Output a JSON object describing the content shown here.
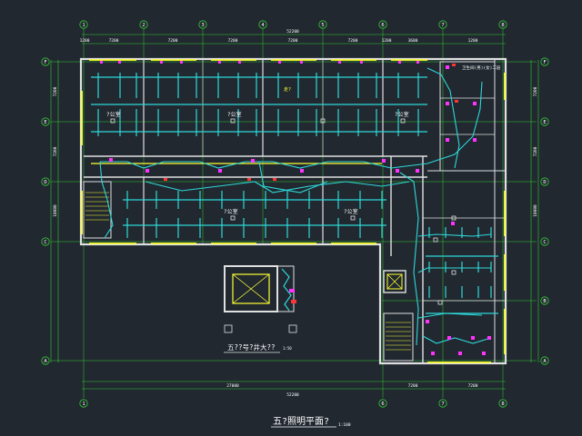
{
  "axes": {
    "top_labels": [
      "1",
      "2",
      "3",
      "4",
      "5",
      "6",
      "7",
      "8"
    ],
    "bottom_labels": [
      "1",
      "6",
      "7",
      "8"
    ],
    "left_labels": [
      "F",
      "E",
      "D",
      "C",
      "A"
    ],
    "right_labels": [
      "F",
      "E",
      "D",
      "C",
      "B",
      "A"
    ]
  },
  "dimensions": {
    "top_segments": [
      "1200",
      "7200",
      "7200",
      "7200",
      "7200",
      "7200",
      "1200",
      "3600",
      "1200"
    ],
    "top_total": "52200",
    "bottom_segments": [
      "27000",
      "7200",
      "7200"
    ],
    "bottom_total": "52200",
    "left_segments": [
      "7200",
      "7200",
      "18000"
    ],
    "right_segments": [
      "7200",
      "7200",
      "18000"
    ]
  },
  "room_labels": {
    "office_1": "?公室",
    "office_2": "?公室",
    "office_3": "?公室",
    "office_4": "?公室",
    "office_5": "?公室",
    "corridor": "走?",
    "toilet_note": "卫生间(男)(女)二层"
  },
  "detail_title": "五??号?井大??",
  "detail_scale": "1:50",
  "drawing_title": "五?照明平面?",
  "drawing_scale": "1:100",
  "colors": {
    "background": "#212830",
    "grid_axis": "#33cc33",
    "wall": "#e0e0e0",
    "window": "#ffff33",
    "wiring": "#2ed8d8",
    "fixture": "#ff33ff",
    "marker": "#ff3333",
    "text": "#ffffff"
  }
}
